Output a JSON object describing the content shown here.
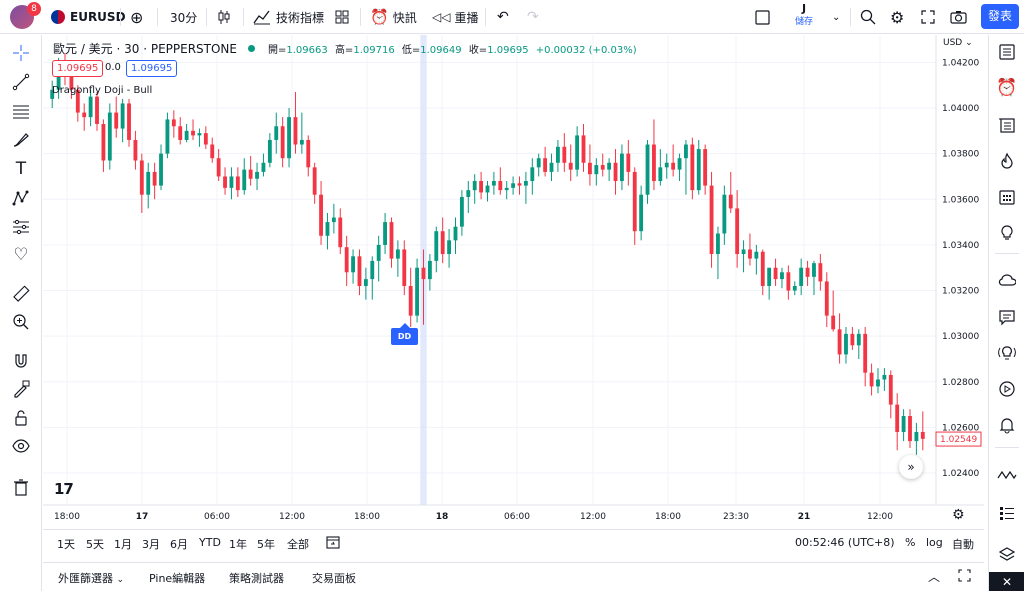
{
  "header": {
    "notification_count": "8",
    "symbol": "EURUSD",
    "interval": "30分",
    "indicators_label": "技術指標",
    "alert_label": "快訊",
    "replay_label": "重播",
    "save_initial": "J",
    "save_label": "儲存",
    "publish_label": "發表"
  },
  "chart": {
    "title": "歐元 / 美元 · 30 · PEPPERSTONE",
    "ohlc": [
      {
        "k": "開=",
        "v": "1.09663"
      },
      {
        "k": "高=",
        "v": "1.09716"
      },
      {
        "k": "低=",
        "v": "1.09649"
      },
      {
        "k": "收=",
        "v": "1.09695"
      },
      {
        "k": "",
        "v": "+0.00032 (+0.03%)"
      }
    ],
    "sell_price": "1.09695",
    "spread": "0.0",
    "buy_price": "1.09695",
    "pattern_label": "Dragonfly Doji - Bull",
    "marker_label": "DD",
    "currency": "USD",
    "last_price": "1.02549",
    "logo": "17"
  },
  "colors": {
    "up": "#089981",
    "down": "#f23645",
    "accent": "#2962ff",
    "highlight": "#d6e0fb"
  },
  "icons": {
    "left": [
      "crosshair-icon",
      "trendline-icon",
      "fib-icon",
      "brush-icon",
      "text-icon",
      "pattern-icon",
      "prediction-icon",
      "heart-icon",
      "ruler-icon",
      "zoom-in-icon",
      "magnet-icon",
      "lock-drawing-icon",
      "unlock-icon",
      "eye-icon",
      "trash-icon"
    ],
    "right": [
      "watchlist-icon",
      "alarm-icon",
      "list-icon",
      "hotlist-icon",
      "calendar-icon",
      "idea-icon",
      "chat-icon",
      "message-icon",
      "lightbulb-icon",
      "stream-icon",
      "bell-icon",
      "wave-icon",
      "settings-list-icon",
      "layers-icon"
    ]
  },
  "range_bar": {
    "ranges": [
      "1天",
      "5天",
      "1月",
      "3月",
      "6月",
      "YTD",
      "1年",
      "5年",
      "全部"
    ],
    "time": "00:52:46 (UTC+8)",
    "percent": "%",
    "log": "log",
    "auto": "自動"
  },
  "bottom_tabs": [
    "外匯篩選器",
    "Pine編輯器",
    "策略測試器",
    "交易面板"
  ],
  "chart_data": {
    "type": "candlestick",
    "title": "",
    "y_ticks": [
      "1.04200",
      "1.04000",
      "1.03800",
      "1.03600",
      "1.03400",
      "1.03200",
      "1.03000",
      "1.02800",
      "1.02600",
      "1.02400"
    ],
    "ylim": [
      1.0226,
      1.0432
    ],
    "x_ticks": [
      "18:00",
      "17",
      "06:00",
      "12:00",
      "18:00",
      "18",
      "06:00",
      "12:00",
      "18:00",
      "23:30",
      "21",
      "12:00"
    ],
    "last_price": 1.02549,
    "highlight_candle_index": 58,
    "candles": [
      [
        1.0404,
        1.0412,
        1.04,
        1.0408
      ],
      [
        1.0408,
        1.0422,
        1.0404,
        1.0419
      ],
      [
        1.0419,
        1.0424,
        1.041,
        1.0415
      ],
      [
        1.0415,
        1.0418,
        1.0404,
        1.0408
      ],
      [
        1.0408,
        1.041,
        1.0394,
        1.0398
      ],
      [
        1.0398,
        1.0402,
        1.039,
        1.0396
      ],
      [
        1.0396,
        1.0408,
        1.0392,
        1.0405
      ],
      [
        1.0405,
        1.0407,
        1.039,
        1.0393
      ],
      [
        1.0393,
        1.0395,
        1.0372,
        1.0377
      ],
      [
        1.0377,
        1.0402,
        1.0373,
        1.0398
      ],
      [
        1.0398,
        1.0405,
        1.0387,
        1.0391
      ],
      [
        1.0391,
        1.0404,
        1.0385,
        1.0402
      ],
      [
        1.0402,
        1.0404,
        1.0383,
        1.0386
      ],
      [
        1.0386,
        1.039,
        1.0373,
        1.0377
      ],
      [
        1.0377,
        1.038,
        1.0354,
        1.0362
      ],
      [
        1.0362,
        1.0376,
        1.0356,
        1.0372
      ],
      [
        1.0372,
        1.0376,
        1.036,
        1.0366
      ],
      [
        1.0366,
        1.0384,
        1.0364,
        1.038
      ],
      [
        1.038,
        1.0398,
        1.0378,
        1.0395
      ],
      [
        1.0395,
        1.0399,
        1.0387,
        1.0392
      ],
      [
        1.0392,
        1.0396,
        1.0384,
        1.0386
      ],
      [
        1.0386,
        1.0393,
        1.0385,
        1.039
      ],
      [
        1.039,
        1.0395,
        1.0386,
        1.0388
      ],
      [
        1.0388,
        1.0391,
        1.0383,
        1.0389
      ],
      [
        1.0389,
        1.0392,
        1.0382,
        1.0384
      ],
      [
        1.0384,
        1.0387,
        1.0376,
        1.0378
      ],
      [
        1.0378,
        1.0382,
        1.0368,
        1.037
      ],
      [
        1.037,
        1.0374,
        1.0362,
        1.0365
      ],
      [
        1.0365,
        1.0374,
        1.036,
        1.037
      ],
      [
        1.037,
        1.0374,
        1.0361,
        1.0364
      ],
      [
        1.0364,
        1.0378,
        1.0362,
        1.0373
      ],
      [
        1.0373,
        1.0379,
        1.0366,
        1.0369
      ],
      [
        1.0369,
        1.0376,
        1.0364,
        1.0372
      ],
      [
        1.0372,
        1.038,
        1.037,
        1.0376
      ],
      [
        1.0376,
        1.0389,
        1.0374,
        1.0386
      ],
      [
        1.0386,
        1.0398,
        1.038,
        1.0392
      ],
      [
        1.0392,
        1.0396,
        1.0374,
        1.0378
      ],
      [
        1.0378,
        1.04,
        1.0374,
        1.0396
      ],
      [
        1.0396,
        1.0407,
        1.038,
        1.0384
      ],
      [
        1.0384,
        1.0398,
        1.038,
        1.0386
      ],
      [
        1.0386,
        1.0388,
        1.037,
        1.0374
      ],
      [
        1.0374,
        1.0376,
        1.0358,
        1.0362
      ],
      [
        1.0362,
        1.0368,
        1.034,
        1.0344
      ],
      [
        1.0344,
        1.0354,
        1.0338,
        1.035
      ],
      [
        1.035,
        1.0358,
        1.0345,
        1.0352
      ],
      [
        1.0352,
        1.0356,
        1.0336,
        1.0339
      ],
      [
        1.0339,
        1.0344,
        1.0322,
        1.0328
      ],
      [
        1.0328,
        1.0338,
        1.0323,
        1.0335
      ],
      [
        1.0335,
        1.0338,
        1.0318,
        1.0322
      ],
      [
        1.0322,
        1.033,
        1.0316,
        1.0325
      ],
      [
        1.0325,
        1.0335,
        1.0316,
        1.0333
      ],
      [
        1.0333,
        1.0344,
        1.0324,
        1.034
      ],
      [
        1.034,
        1.0354,
        1.0336,
        1.035
      ],
      [
        1.035,
        1.0352,
        1.033,
        1.0334
      ],
      [
        1.0334,
        1.0342,
        1.0326,
        1.0338
      ],
      [
        1.0338,
        1.0342,
        1.0318,
        1.0322
      ],
      [
        1.0322,
        1.033,
        1.0304,
        1.0309
      ],
      [
        1.0309,
        1.0334,
        1.0306,
        1.033
      ],
      [
        1.033,
        1.0338,
        1.0305,
        1.0325
      ],
      [
        1.0325,
        1.0336,
        1.032,
        1.0333
      ],
      [
        1.0333,
        1.0348,
        1.0328,
        1.0346
      ],
      [
        1.0346,
        1.0352,
        1.0332,
        1.0336
      ],
      [
        1.0336,
        1.0347,
        1.033,
        1.0342
      ],
      [
        1.0342,
        1.0352,
        1.0336,
        1.0348
      ],
      [
        1.0348,
        1.0364,
        1.0344,
        1.0361
      ],
      [
        1.0361,
        1.0368,
        1.0354,
        1.0364
      ],
      [
        1.0364,
        1.0371,
        1.0358,
        1.0368
      ],
      [
        1.0368,
        1.0372,
        1.036,
        1.0363
      ],
      [
        1.0363,
        1.0368,
        1.0359,
        1.0366
      ],
      [
        1.0366,
        1.0372,
        1.0362,
        1.0368
      ],
      [
        1.0368,
        1.0374,
        1.0362,
        1.0364
      ],
      [
        1.0364,
        1.0368,
        1.036,
        1.0365
      ],
      [
        1.0365,
        1.037,
        1.0362,
        1.0367
      ],
      [
        1.0367,
        1.037,
        1.0362,
        1.0366
      ],
      [
        1.0366,
        1.0372,
        1.0358,
        1.0368
      ],
      [
        1.0368,
        1.0378,
        1.0362,
        1.0374
      ],
      [
        1.0374,
        1.038,
        1.037,
        1.0378
      ],
      [
        1.0378,
        1.0383,
        1.037,
        1.0372
      ],
      [
        1.0372,
        1.038,
        1.0368,
        1.0376
      ],
      [
        1.0376,
        1.0386,
        1.0372,
        1.0383
      ],
      [
        1.0383,
        1.0389,
        1.0372,
        1.0376
      ],
      [
        1.0376,
        1.0384,
        1.0368,
        1.0373
      ],
      [
        1.0373,
        1.0392,
        1.037,
        1.0388
      ],
      [
        1.0388,
        1.0393,
        1.0372,
        1.0376
      ],
      [
        1.0376,
        1.0384,
        1.0366,
        1.0371
      ],
      [
        1.0371,
        1.0378,
        1.0366,
        1.0375
      ],
      [
        1.0375,
        1.038,
        1.037,
        1.0373
      ],
      [
        1.0373,
        1.0378,
        1.0368,
        1.0376
      ],
      [
        1.0376,
        1.0382,
        1.0362,
        1.0368
      ],
      [
        1.0368,
        1.0384,
        1.0364,
        1.038
      ],
      [
        1.038,
        1.0386,
        1.0366,
        1.0372
      ],
      [
        1.0372,
        1.0374,
        1.034,
        1.0346
      ],
      [
        1.0346,
        1.0366,
        1.0342,
        1.0362
      ],
      [
        1.0362,
        1.0386,
        1.0358,
        1.0384
      ],
      [
        1.0384,
        1.0395,
        1.0364,
        1.0368
      ],
      [
        1.0368,
        1.0382,
        1.0366,
        1.0374
      ],
      [
        1.0374,
        1.038,
        1.0369,
        1.0376
      ],
      [
        1.0376,
        1.0384,
        1.037,
        1.0373
      ],
      [
        1.0373,
        1.038,
        1.0368,
        1.0378
      ],
      [
        1.0378,
        1.0386,
        1.0362,
        1.0384
      ],
      [
        1.0384,
        1.0387,
        1.036,
        1.0364
      ],
      [
        1.0364,
        1.0386,
        1.0362,
        1.0382
      ],
      [
        1.0382,
        1.0384,
        1.0362,
        1.0366
      ],
      [
        1.0366,
        1.0372,
        1.033,
        1.0336
      ],
      [
        1.0336,
        1.0348,
        1.0325,
        1.0345
      ],
      [
        1.0345,
        1.0366,
        1.034,
        1.0362
      ],
      [
        1.0362,
        1.0372,
        1.0354,
        1.0356
      ],
      [
        1.0356,
        1.0364,
        1.033,
        1.0336
      ],
      [
        1.0336,
        1.0342,
        1.0328,
        1.0338
      ],
      [
        1.0338,
        1.0345,
        1.0331,
        1.0334
      ],
      [
        1.0334,
        1.034,
        1.0327,
        1.0337
      ],
      [
        1.0337,
        1.0338,
        1.0318,
        1.0322
      ],
      [
        1.0322,
        1.0328,
        1.0316,
        1.033
      ],
      [
        1.033,
        1.0334,
        1.0322,
        1.0325
      ],
      [
        1.0325,
        1.033,
        1.0321,
        1.0328
      ],
      [
        1.0328,
        1.0331,
        1.0316,
        1.032
      ],
      [
        1.032,
        1.0324,
        1.0318,
        1.0322
      ],
      [
        1.0322,
        1.0334,
        1.0318,
        1.033
      ],
      [
        1.033,
        1.0333,
        1.0322,
        1.0326
      ],
      [
        1.0326,
        1.0333,
        1.0318,
        1.0332
      ],
      [
        1.0332,
        1.0336,
        1.032,
        1.0324
      ],
      [
        1.0324,
        1.0328,
        1.0304,
        1.0309
      ],
      [
        1.0309,
        1.032,
        1.0302,
        1.0303
      ],
      [
        1.0303,
        1.031,
        1.0288,
        1.0292
      ],
      [
        1.0292,
        1.0304,
        1.0288,
        1.0301
      ],
      [
        1.0301,
        1.0304,
        1.0294,
        1.0296
      ],
      [
        1.0296,
        1.0303,
        1.029,
        1.0301
      ],
      [
        1.0301,
        1.0304,
        1.0278,
        1.0284
      ],
      [
        1.0284,
        1.0288,
        1.0274,
        1.0278
      ],
      [
        1.0278,
        1.0286,
        1.0275,
        1.0281
      ],
      [
        1.0281,
        1.0286,
        1.0276,
        1.0283
      ],
      [
        1.0283,
        1.0285,
        1.0264,
        1.027
      ],
      [
        1.027,
        1.0275,
        1.025,
        1.0258
      ],
      [
        1.0258,
        1.0268,
        1.0254,
        1.0265
      ],
      [
        1.0265,
        1.0268,
        1.0251,
        1.0254
      ],
      [
        1.0254,
        1.0262,
        1.0248,
        1.0258
      ],
      [
        1.0258,
        1.0267,
        1.025,
        1.0255
      ]
    ]
  }
}
